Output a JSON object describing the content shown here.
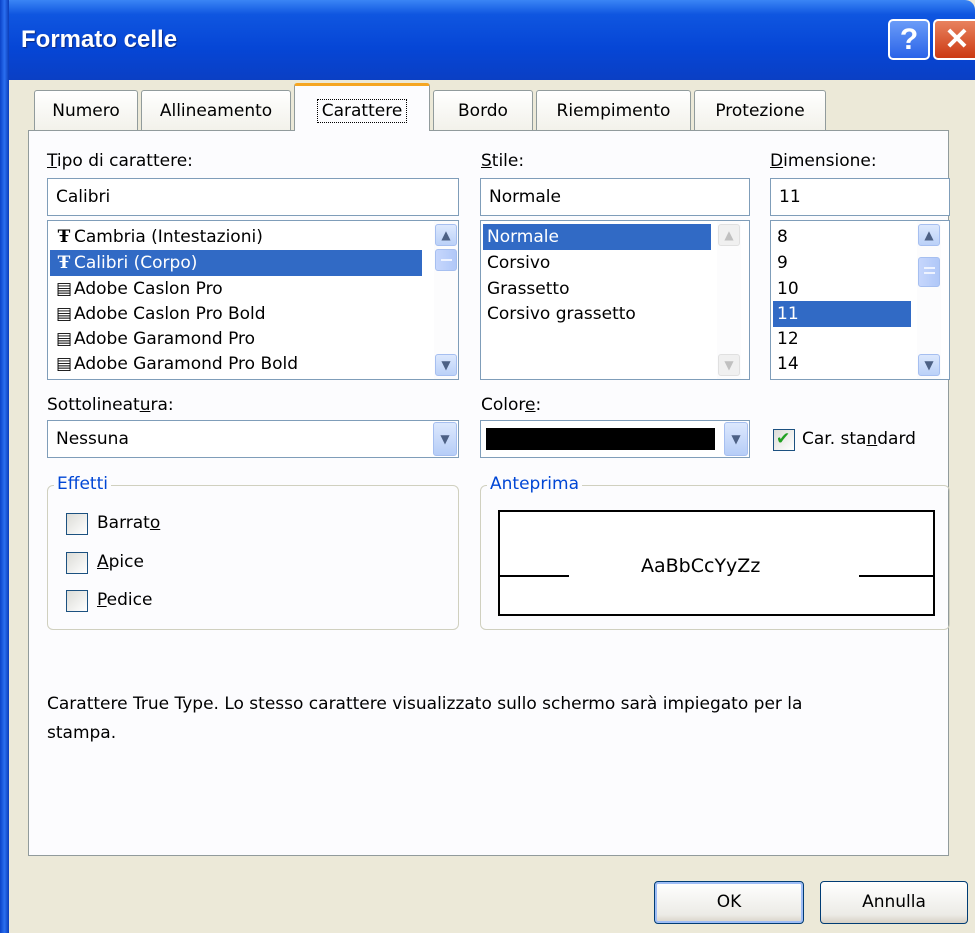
{
  "window": {
    "title": "Formato celle",
    "help_glyph": "?",
    "close_glyph": "✕"
  },
  "tabs": [
    {
      "label": "Numero"
    },
    {
      "label": "Allineamento"
    },
    {
      "label": "Carattere",
      "active": true
    },
    {
      "label": "Bordo"
    },
    {
      "label": "Riempimento"
    },
    {
      "label": "Protezione"
    }
  ],
  "font": {
    "label_pre": "T",
    "label_post": "ipo di carattere:",
    "value": "Calibri",
    "items": [
      {
        "icon": "truetype-font-icon",
        "glyph": "Ŧ",
        "label": "Cambria (Intestazioni)"
      },
      {
        "icon": "truetype-font-icon",
        "glyph": "Ŧ",
        "label": "Calibri (Corpo)",
        "selected": true
      },
      {
        "icon": "opentype-font-icon",
        "glyph": "▤",
        "label": "Adobe Caslon Pro"
      },
      {
        "icon": "opentype-font-icon",
        "glyph": "▤",
        "label": "Adobe Caslon Pro Bold"
      },
      {
        "icon": "opentype-font-icon",
        "glyph": "▤",
        "label": "Adobe Garamond Pro"
      },
      {
        "icon": "opentype-font-icon",
        "glyph": "▤",
        "label": "Adobe Garamond Pro Bold"
      }
    ]
  },
  "style": {
    "label_pre": "S",
    "label_post": "tile:",
    "value": "Normale",
    "items": [
      {
        "label": "Normale",
        "selected": true
      },
      {
        "label": "Corsivo"
      },
      {
        "label": "Grassetto"
      },
      {
        "label": "Corsivo grassetto"
      }
    ]
  },
  "size": {
    "label_pre": "D",
    "label_post": "imensione:",
    "value": "11",
    "items": [
      {
        "label": "8"
      },
      {
        "label": "9"
      },
      {
        "label": "10"
      },
      {
        "label": "11",
        "selected": true
      },
      {
        "label": "12"
      },
      {
        "label": "14"
      }
    ]
  },
  "underline": {
    "label_pre": "Sottolineat",
    "label_u": "u",
    "label_post": "ra:",
    "value": "Nessuna"
  },
  "color": {
    "label_pre": "Color",
    "label_u": "e",
    "label_post": ":",
    "swatch": "#000000"
  },
  "normal_font": {
    "label_pre": "Car. sta",
    "label_u": "n",
    "label_post": "dard",
    "checked": true
  },
  "effects": {
    "title": "Effetti",
    "items": [
      {
        "pre": "Barrat",
        "u": "o",
        "post": "",
        "checked": false
      },
      {
        "pre": "",
        "u": "A",
        "post": "pice",
        "checked": false
      },
      {
        "pre": "",
        "u": "P",
        "post": "edice",
        "checked": false
      }
    ]
  },
  "preview": {
    "title": "Anteprima",
    "sample": "AaBbCcYyZz"
  },
  "info_text": "Carattere True Type. Lo stesso carattere visualizzato sullo schermo sarà impiegato per la",
  "info_text_2": "stampa.",
  "buttons": {
    "ok": "OK",
    "cancel": "Annulla"
  },
  "arrows": {
    "up": "▲",
    "down": "▼"
  },
  "colors": {
    "title_bar": "#0646d6",
    "selection": "#316ac5",
    "dialog_bg": "#ece9d8",
    "group_title": "#0046d5"
  }
}
